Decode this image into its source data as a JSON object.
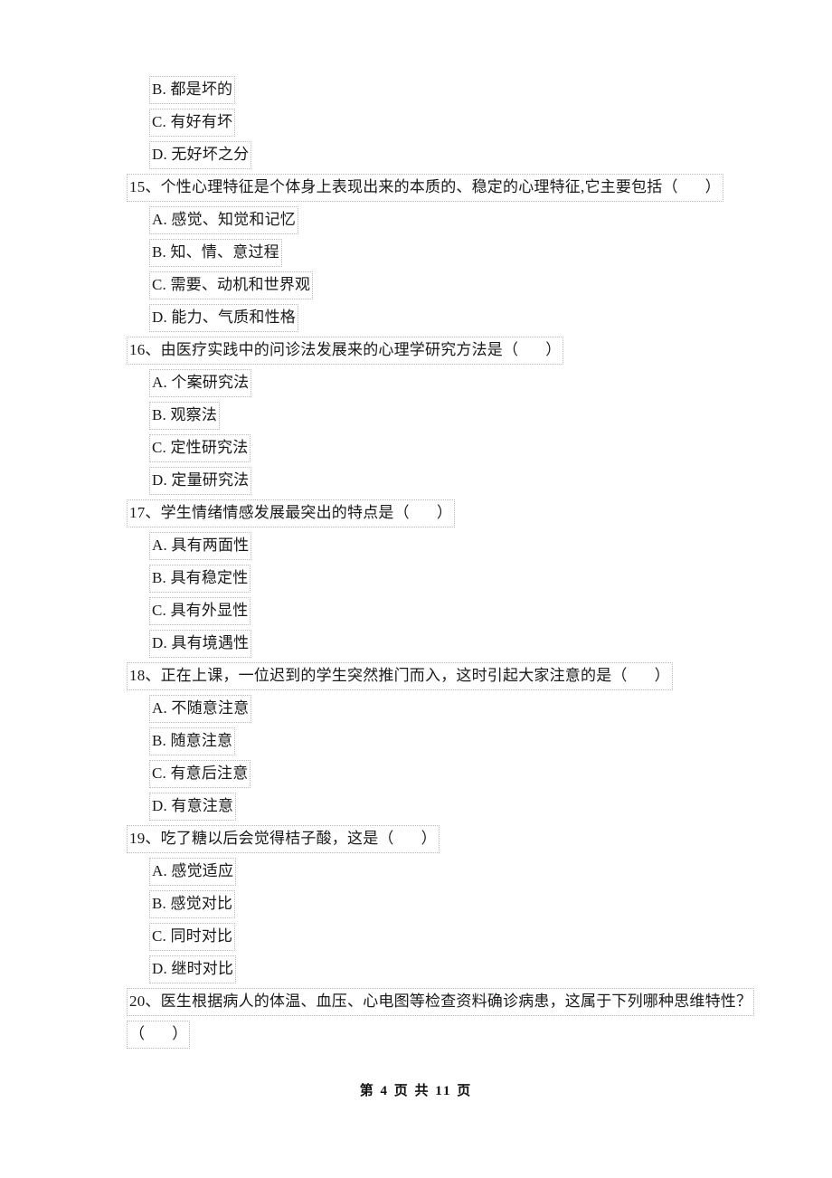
{
  "document": {
    "page_footer": {
      "prefix": "第",
      "current_page": "4",
      "middle": "页 共",
      "total_pages": "11",
      "suffix": "页",
      "full_text": "第 4 页 共 11 页"
    }
  },
  "leading_options": [
    {
      "label": "B. 都是坏的"
    },
    {
      "label": "C. 有好有坏"
    },
    {
      "label": "D. 无好坏之分"
    }
  ],
  "questions": [
    {
      "number": "15、",
      "stem": "个性心理特征是个体身上表现出来的本质的、稳定的心理特征,它主要包括（",
      "stem_close": "）",
      "options": [
        {
          "label": "A. 感觉、知觉和记忆"
        },
        {
          "label": "B. 知、情、意过程"
        },
        {
          "label": "C. 需要、动机和世界观"
        },
        {
          "label": "D. 能力、气质和性格"
        }
      ]
    },
    {
      "number": "16、",
      "stem": "由医疗实践中的问诊法发展来的心理学研究方法是（",
      "stem_close": "）",
      "options": [
        {
          "label": "A. 个案研究法"
        },
        {
          "label": "B. 观察法"
        },
        {
          "label": "C. 定性研究法"
        },
        {
          "label": "D. 定量研究法"
        }
      ]
    },
    {
      "number": "17、",
      "stem": "学生情绪情感发展最突出的特点是（",
      "stem_close": "）",
      "options": [
        {
          "label": "A. 具有两面性"
        },
        {
          "label": "B. 具有稳定性"
        },
        {
          "label": "C. 具有外显性"
        },
        {
          "label": "D. 具有境遇性"
        }
      ]
    },
    {
      "number": "18、",
      "stem": "正在上课，一位迟到的学生突然推门而入，这时引起大家注意的是（",
      "stem_close": "）",
      "options": [
        {
          "label": "A. 不随意注意"
        },
        {
          "label": "B. 随意注意"
        },
        {
          "label": "C. 有意后注意"
        },
        {
          "label": "D. 有意注意"
        }
      ]
    },
    {
      "number": "19、",
      "stem": "吃了糖以后会觉得桔子酸，这是（",
      "stem_close": "）",
      "options": [
        {
          "label": "A. 感觉适应"
        },
        {
          "label": "B. 感觉对比"
        },
        {
          "label": "C. 同时对比"
        },
        {
          "label": "D. 继时对比"
        }
      ]
    },
    {
      "number": "20、",
      "stem": "医生根据病人的体温、血压、心电图等检查资料确诊病患，这属于下列哪种思维特性？",
      "continuation": "（",
      "continuation_close": "）",
      "options": []
    }
  ]
}
